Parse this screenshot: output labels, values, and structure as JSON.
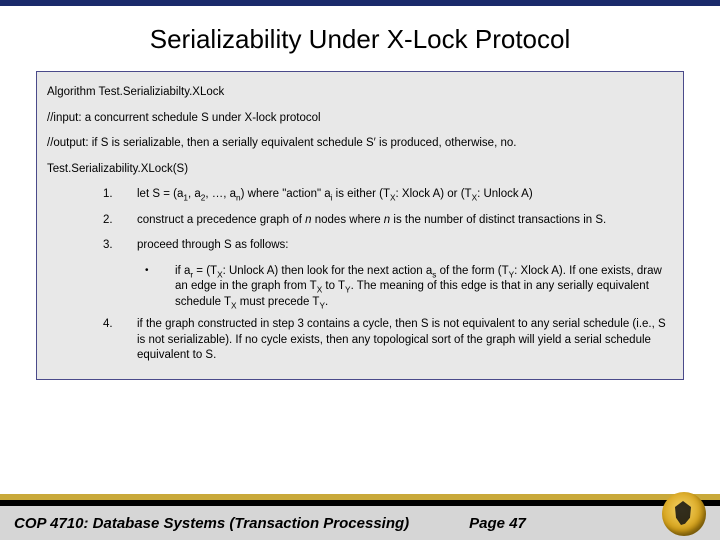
{
  "slide": {
    "title": "Serializability Under X-Lock Protocol",
    "algo_heading": "Algorithm Test.Serializiabilty.XLock",
    "input_line": "//input:  a concurrent schedule S under X-lock protocol",
    "output_prefix": "//output: if S is serializable, then a serially equivalent schedule S",
    "output_suffix": " is produced, otherwise, no.",
    "call_line": "Test.Serializability.XLock(S)",
    "steps": {
      "s1": {
        "num": "1.",
        "pre": "let S = (a",
        "mid1": ", a",
        "mid2": ", …, a",
        "post1": ") where \"action\" a",
        "post2": " is either (T",
        "post3": ": Xlock A) or (T",
        "post4": ": Unlock A)",
        "sub1": "1",
        "sub2": "2",
        "subn": "n",
        "subi": "i",
        "subx1": "X",
        "subx2": "X"
      },
      "s2": {
        "num": "2.",
        "text_a": "construct a precedence graph of ",
        "text_b": " nodes where ",
        "text_c": " is the number of distinct transactions in S.",
        "n": "n"
      },
      "s3": {
        "num": "3.",
        "text": "proceed through S as follows:"
      },
      "s3b": {
        "bullet": "•",
        "t1": "if a",
        "sub_r": "r",
        "t2": " = (T",
        "subx": "X",
        "t3": ": Unlock A) then look for the next action a",
        "sub_s": "s",
        "t4": " of the form (T",
        "suby": "Y",
        "t5": ": Xlock A). If one exists, draw an edge in the graph from T",
        "t6": " to T",
        "t7": ".  The meaning of this edge is that in any serially equivalent schedule T",
        "t8": " must precede T",
        "t9": "."
      },
      "s4": {
        "num": "4.",
        "text": "if the graph constructed in step 3 contains a cycle, then S is not equivalent to any serial schedule (i.e., S is not serializable).  If no cycle exists, then any topological sort of the graph will yield a serial schedule equivalent to S."
      }
    }
  },
  "footer": {
    "left": "COP 4710: Database Systems  (Transaction Processing)",
    "page": "Page 47"
  }
}
